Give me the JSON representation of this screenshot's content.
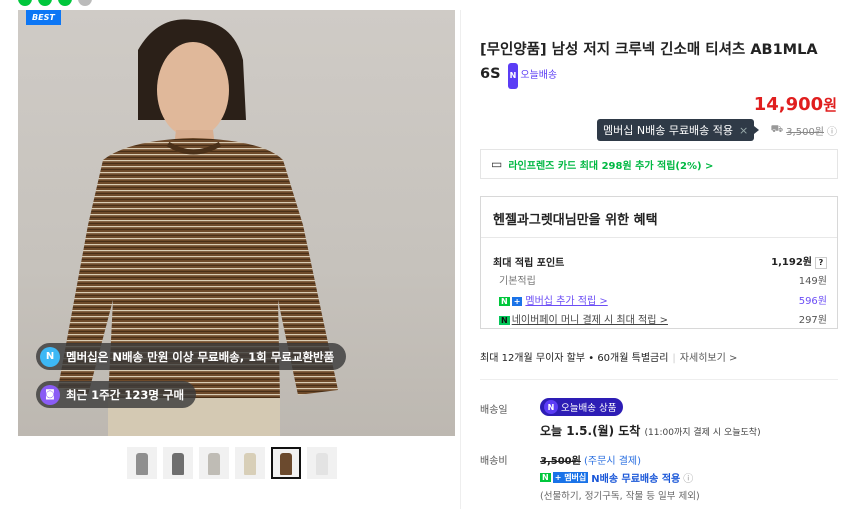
{
  "badge": {
    "best": "BEST"
  },
  "pills": {
    "membership": "멤버십은 N배송 만원 이상 무료배송, 1회 무료교환반품",
    "recent": "최근 1주간 123명 구매"
  },
  "product": {
    "title": "[무인양품] 남성 저지 크루넥 긴소매 티셔츠 AB1MLA 6S",
    "today_label": "오늘배송",
    "price_num": "14,900",
    "price_unit": "원",
    "tooltip": "멤버십 N배송 무료배송 적용",
    "tooltip_close": "×",
    "orig_shipping": "3,500원",
    "info_icon": "ⓘ"
  },
  "card_promo": "라인프렌즈 카드 최대 298원 추가 적립(2%) >",
  "benefit": {
    "title": "헨젤과그렛대님만을 위한 혜택",
    "max_label": "최대 적립 포인트",
    "max_value": "1,192원",
    "help": "?",
    "rows": [
      {
        "label": "기본적립",
        "value": "149원"
      },
      {
        "label": "멤버십 추가 적립 >",
        "value": "596원"
      },
      {
        "label": "네이버페이 머니 결제 시 최대 적립 >",
        "value": "297원"
      }
    ]
  },
  "installment": {
    "text": "최대 12개월 무이자 할부 • 60개월 특별금리",
    "more": "자세히보기 >"
  },
  "delivery": {
    "label": "배송일",
    "tag": "오늘배송 상품",
    "arrive": "오늘 1.5.(월) 도착",
    "arrive_note": "(11:00까지 결제 시 오늘도착)"
  },
  "fee": {
    "label": "배송비",
    "orig": "3,500원",
    "note": "(주문시 결제)",
    "applied": "N배송 무료배송 적용",
    "exclude": "(선물하기, 정기구독, 작물 등 일부 제외)"
  },
  "colors": {
    "accent": "#00c73c",
    "price": "#e01e1e",
    "purple": "#5b3df5"
  },
  "thumbnail_colors": [
    "#8f8f8f",
    "#6e6e6e",
    "#bfbcb5",
    "#d8cfb8",
    "#6b4a2e",
    "#e3e3e3"
  ]
}
